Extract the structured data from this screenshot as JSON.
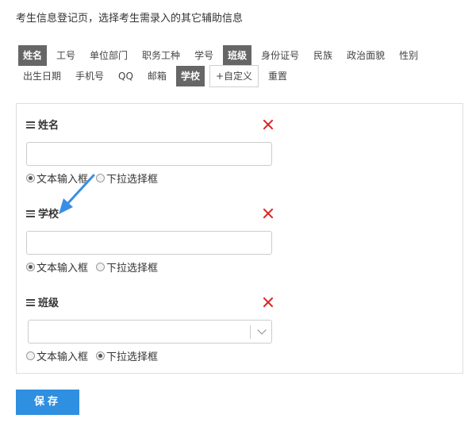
{
  "intro_text": "考生信息登记页，选择考生需录入的其它辅助信息",
  "chips_row1": [
    {
      "label": "姓名",
      "active": true
    },
    {
      "label": "工号",
      "active": false
    },
    {
      "label": "单位部门",
      "active": false
    },
    {
      "label": "职务工种",
      "active": false
    },
    {
      "label": "学号",
      "active": false
    },
    {
      "label": "班级",
      "active": true
    },
    {
      "label": "身份证号",
      "active": false
    },
    {
      "label": "民族",
      "active": false
    },
    {
      "label": "政治面貌",
      "active": false
    },
    {
      "label": "性别",
      "active": false
    }
  ],
  "chips_row2": [
    {
      "label": "出生日期",
      "active": false
    },
    {
      "label": "手机号",
      "active": false
    },
    {
      "label": "QQ",
      "active": false
    },
    {
      "label": "邮箱",
      "active": false
    },
    {
      "label": "学校",
      "active": true
    },
    {
      "label": "+自定义",
      "active": false
    },
    {
      "label": "重置",
      "active": false
    }
  ],
  "fields": [
    {
      "title": "姓名",
      "input_type": "text",
      "radio_text": "文本输入框",
      "radio_select": "下拉选择框"
    },
    {
      "title": "学校",
      "input_type": "text",
      "radio_text": "文本输入框",
      "radio_select": "下拉选择框"
    },
    {
      "title": "班级",
      "input_type": "select",
      "radio_text": "文本输入框",
      "radio_select": "下拉选择框"
    }
  ],
  "save_label": "保存",
  "colors": {
    "active_chip": "#666666",
    "delete": "#e02020",
    "save": "#2f8fe0",
    "arrow": "#3a8ee6"
  }
}
